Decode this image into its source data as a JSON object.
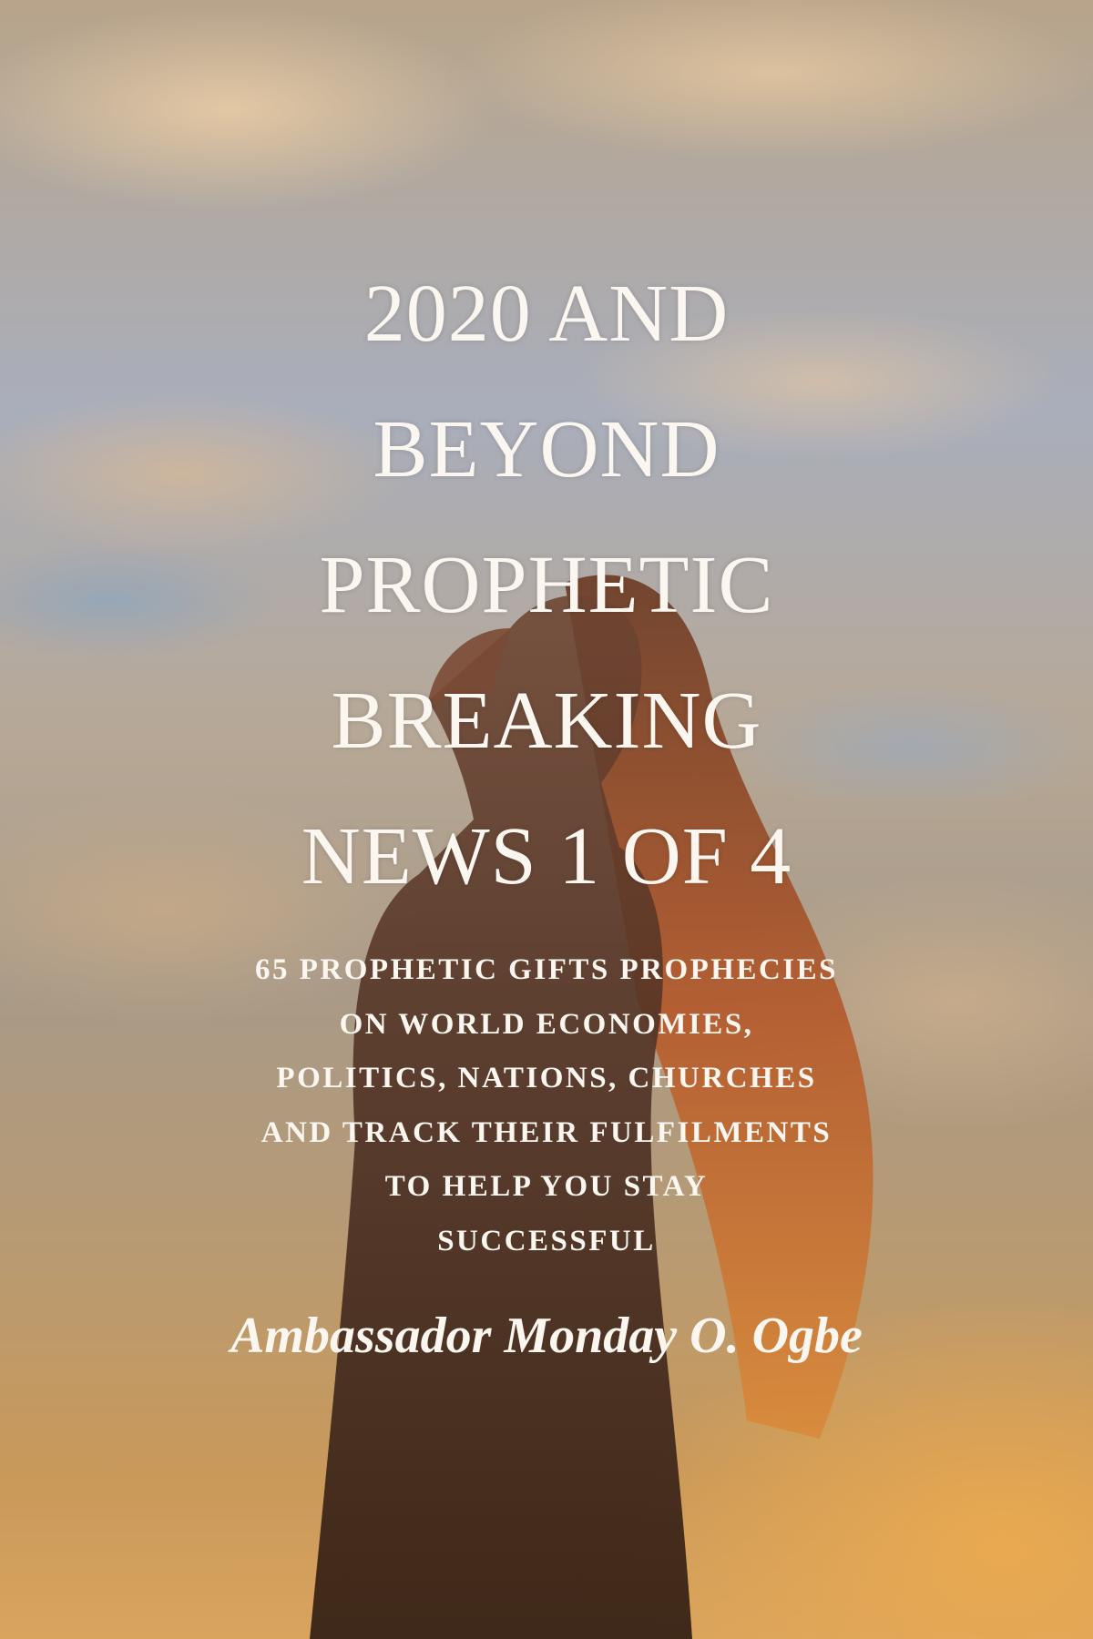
{
  "cover": {
    "title_lines": [
      "2020 AND",
      "BEYOND",
      "PROPHETIC",
      "BREAKING",
      "NEWS 1 OF 4"
    ],
    "subtitle_lines": [
      "65 PROPHETIC GIFTS PROPHECIES",
      "ON WORLD ECONOMIES,",
      "POLITICS, NATIONS, CHURCHES",
      "AND TRACK THEIR FULFILMENTS",
      "TO HELP YOU STAY",
      "SUCCESSFUL"
    ],
    "author": "Ambassador Monday O. Ogbe"
  }
}
